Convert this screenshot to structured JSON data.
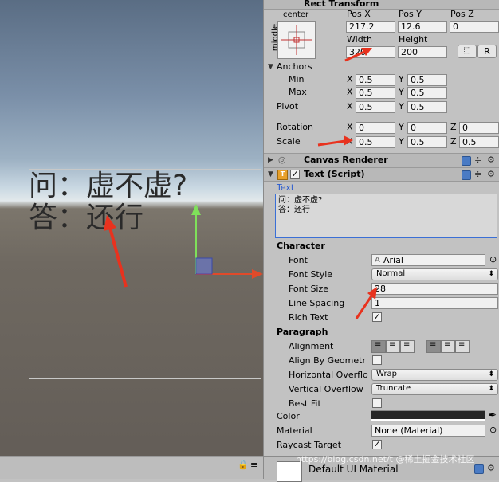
{
  "scene": {
    "canvas_text_line1": "问：虚不虚?",
    "canvas_text_line2": "答：还行"
  },
  "rect_transform": {
    "title": "Rect Transform",
    "anchor_preset_h": "center",
    "anchor_preset_v": "middle",
    "pos_x_label": "Pos X",
    "pos_y_label": "Pos Y",
    "pos_z_label": "Pos Z",
    "pos_x": "217.2",
    "pos_y": "12.6",
    "pos_z": "0",
    "width_label": "Width",
    "height_label": "Height",
    "width": "320",
    "height": "200",
    "r_button": "R",
    "anchors_label": "Anchors",
    "min_label": "Min",
    "max_label": "Max",
    "min_x": "0.5",
    "min_y": "0.5",
    "max_x": "0.5",
    "max_y": "0.5",
    "pivot_label": "Pivot",
    "pivot_x": "0.5",
    "pivot_y": "0.5",
    "rotation_label": "Rotation",
    "rot_x": "0",
    "rot_y": "0",
    "rot_z": "0",
    "scale_label": "Scale",
    "scale_x": "0.5",
    "scale_y": "0.5",
    "scale_z": "0.5",
    "x": "X",
    "y": "Y",
    "z": "Z"
  },
  "canvas_renderer": {
    "title": "Canvas Renderer"
  },
  "text_script": {
    "title": "Text (Script)",
    "text_label": "Text",
    "text_line1": "问：虚不虚?",
    "text_line2": "答：还行",
    "character_label": "Character",
    "font_label": "Font",
    "font_value": "Arial",
    "font_style_label": "Font Style",
    "font_style_value": "Normal",
    "font_size_label": "Font Size",
    "font_size_value": "28",
    "line_spacing_label": "Line Spacing",
    "line_spacing_value": "1",
    "rich_text_label": "Rich Text",
    "paragraph_label": "Paragraph",
    "alignment_label": "Alignment",
    "align_by_geometry_label": "Align By Geometr",
    "h_overflow_label": "Horizontal Overflo",
    "h_overflow_value": "Wrap",
    "v_overflow_label": "Vertical Overflow",
    "v_overflow_value": "Truncate",
    "best_fit_label": "Best Fit",
    "color_label": "Color",
    "material_label": "Material",
    "material_value": "None (Material)",
    "raycast_label": "Raycast Target"
  },
  "footer": {
    "material_name": "Default UI Material"
  },
  "watermark": "https://blog.csdn.net/t  @稀土掘金技术社区"
}
